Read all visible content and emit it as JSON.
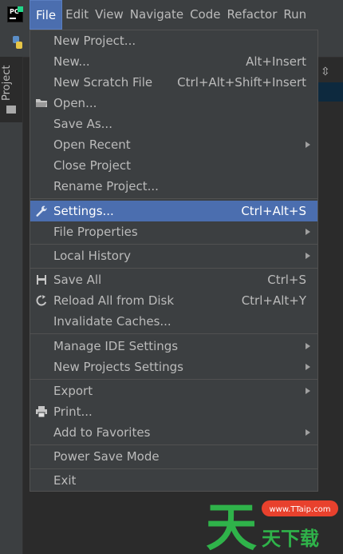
{
  "menubar": {
    "items": [
      "File",
      "Edit",
      "View",
      "Navigate",
      "Code",
      "Refactor",
      "Run"
    ],
    "active_index": 0
  },
  "side_panel": {
    "tab_label": "Project"
  },
  "file_menu": {
    "items": [
      {
        "label": "New Project...",
        "shortcut": "",
        "submenu": false,
        "icon": ""
      },
      {
        "label": "New...",
        "shortcut": "Alt+Insert",
        "submenu": false,
        "icon": ""
      },
      {
        "label": "New Scratch File",
        "shortcut": "Ctrl+Alt+Shift+Insert",
        "submenu": false,
        "icon": ""
      },
      {
        "label": "Open...",
        "shortcut": "",
        "submenu": false,
        "icon": "folder-icon"
      },
      {
        "label": "Save As...",
        "shortcut": "",
        "submenu": false,
        "icon": ""
      },
      {
        "label": "Open Recent",
        "shortcut": "",
        "submenu": true,
        "icon": ""
      },
      {
        "label": "Close Project",
        "shortcut": "",
        "submenu": false,
        "icon": ""
      },
      {
        "label": "Rename Project...",
        "shortcut": "",
        "submenu": false,
        "icon": ""
      },
      {
        "label": "Settings...",
        "shortcut": "Ctrl+Alt+S",
        "submenu": false,
        "icon": "wrench-icon",
        "selected": true
      },
      {
        "label": "File Properties",
        "shortcut": "",
        "submenu": true,
        "icon": ""
      },
      {
        "label": "Local History",
        "shortcut": "",
        "submenu": true,
        "icon": ""
      },
      {
        "label": "Save All",
        "shortcut": "Ctrl+S",
        "submenu": false,
        "icon": "save-icon"
      },
      {
        "label": "Reload All from Disk",
        "shortcut": "Ctrl+Alt+Y",
        "submenu": false,
        "icon": "reload-icon"
      },
      {
        "label": "Invalidate Caches...",
        "shortcut": "",
        "submenu": false,
        "icon": ""
      },
      {
        "label": "Manage IDE Settings",
        "shortcut": "",
        "submenu": true,
        "icon": ""
      },
      {
        "label": "New Projects Settings",
        "shortcut": "",
        "submenu": true,
        "icon": ""
      },
      {
        "label": "Export",
        "shortcut": "",
        "submenu": true,
        "icon": ""
      },
      {
        "label": "Print...",
        "shortcut": "",
        "submenu": false,
        "icon": "printer-icon"
      },
      {
        "label": "Add to Favorites",
        "shortcut": "",
        "submenu": true,
        "icon": ""
      },
      {
        "label": "Power Save Mode",
        "shortcut": "",
        "submenu": false,
        "icon": ""
      },
      {
        "label": "Exit",
        "shortcut": "",
        "submenu": false,
        "icon": ""
      }
    ]
  },
  "watermark": {
    "site": "www.TTaip.com",
    "text": "天天下载"
  },
  "colors": {
    "accent": "#4b6eaf",
    "menu_bg": "#3c3f41",
    "text": "#bbbbbb"
  }
}
